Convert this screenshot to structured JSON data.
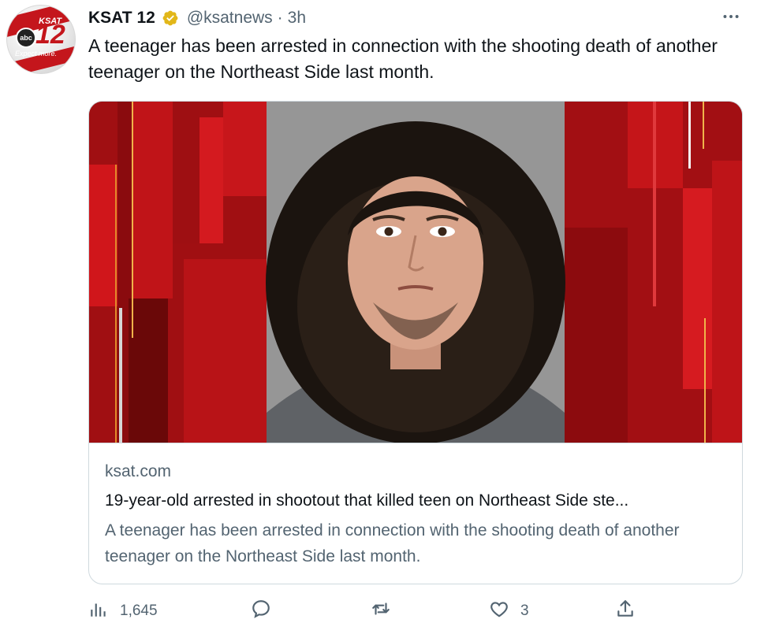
{
  "account": {
    "name": "KSAT 12",
    "handle": "@ksatnews",
    "separator": "·",
    "time": "3h",
    "avatar_text": {
      "brand": "KSAT",
      "number": "12",
      "network": "abc",
      "tagline": "Expect more."
    }
  },
  "tweet": {
    "text": "A teenager has been arrested in connection with the shooting death of another teenager on the Northeast Side last month."
  },
  "card": {
    "domain": "ksat.com",
    "title": "19-year-old arrested in shootout that killed teen on Northeast Side ste...",
    "description": "A teenager has been arrested in connection with the shooting death of another teenager on the Northeast Side last month."
  },
  "actions": {
    "views": "1,645",
    "likes": "3"
  },
  "icons": {
    "verified": "verified-badge-icon",
    "more": "more-icon",
    "views": "analytics-icon",
    "reply": "reply-icon",
    "retweet": "retweet-icon",
    "like": "like-icon",
    "share": "share-icon"
  },
  "colors": {
    "text": "#0f1419",
    "secondary": "#536471",
    "verified": "#e2b719",
    "brand_red": "#c4161c"
  }
}
